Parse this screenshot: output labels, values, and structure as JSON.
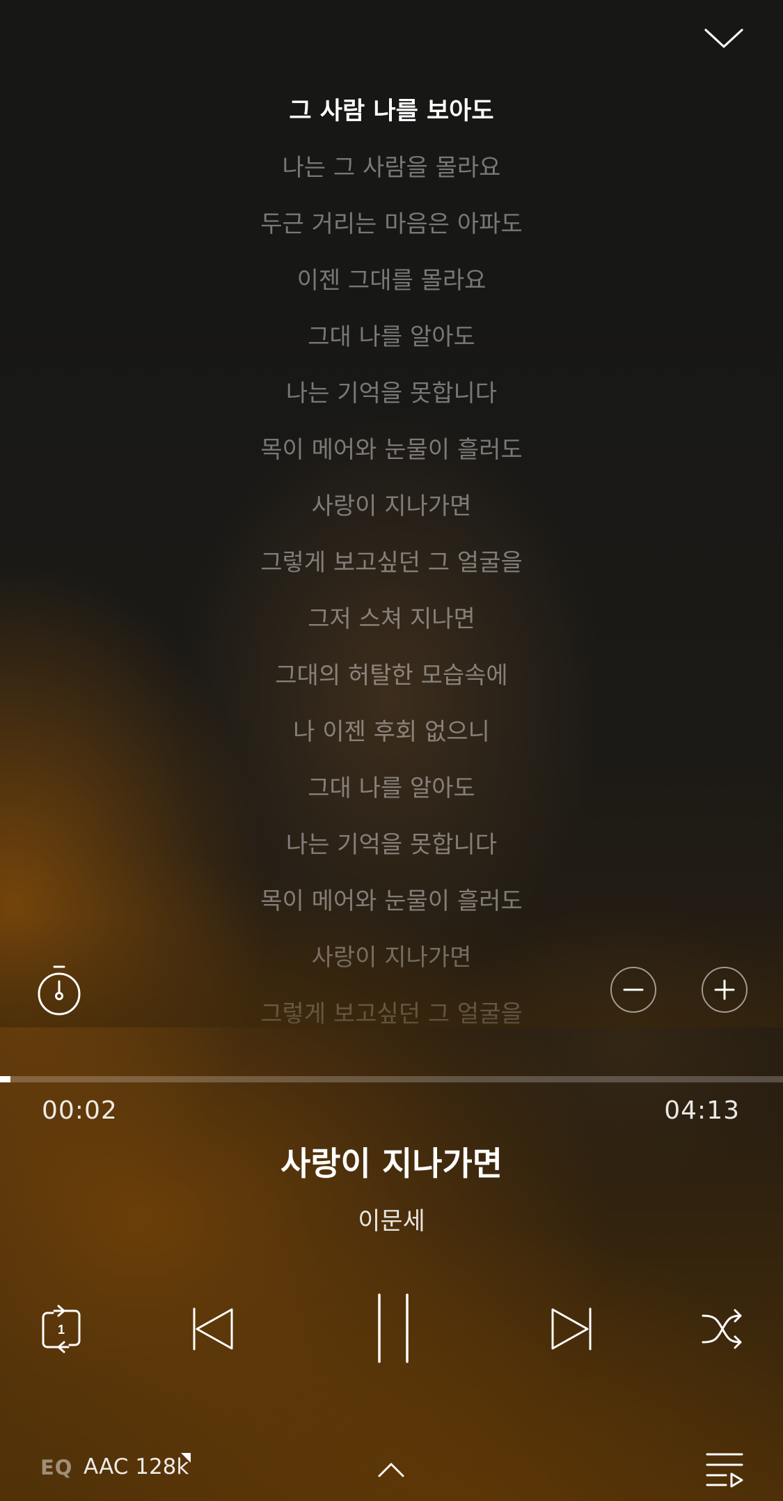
{
  "lyrics": [
    "그 사람 나를 보아도",
    "나는 그 사람을 몰라요",
    "두근 거리는 마음은 아파도",
    "이젠 그대를 몰라요",
    "그대 나를 알아도",
    "나는 기억을 못합니다",
    "목이 메어와 눈물이 흘러도",
    "사랑이 지나가면",
    "그렇게 보고싶던 그 얼굴을",
    "그저 스쳐 지나면",
    "그대의 허탈한 모습속에",
    "나 이젠 후회 없으니",
    "그대 나를 알아도",
    "나는 기억을 못합니다",
    "목이 메어와 눈물이 흘러도",
    "사랑이 지나가면",
    "그렇게 보고싶던 그 얼굴을"
  ],
  "active_lyric_index": 0,
  "player": {
    "elapsed": "00:02",
    "total": "04:13",
    "progress_fraction": 0.013,
    "title": "사랑이 지나가면",
    "artist": "이문세",
    "repeat_mode_badge": "1"
  },
  "footer": {
    "eq_label": "EQ",
    "codec_label": "AAC 128k"
  },
  "icons": {
    "collapse": "chevron-down-icon",
    "timer": "sleep-timer-icon",
    "font_smaller": "minus-icon",
    "font_larger": "plus-icon",
    "repeat": "repeat-one-icon",
    "previous": "previous-track-icon",
    "pause": "pause-icon",
    "next": "next-track-icon",
    "shuffle": "shuffle-icon",
    "expand": "chevron-up-icon",
    "playlist": "playlist-icon"
  },
  "colors": {
    "accent_warm": "#6e4008",
    "background_dark": "#171716",
    "text_primary": "#ffffff"
  }
}
